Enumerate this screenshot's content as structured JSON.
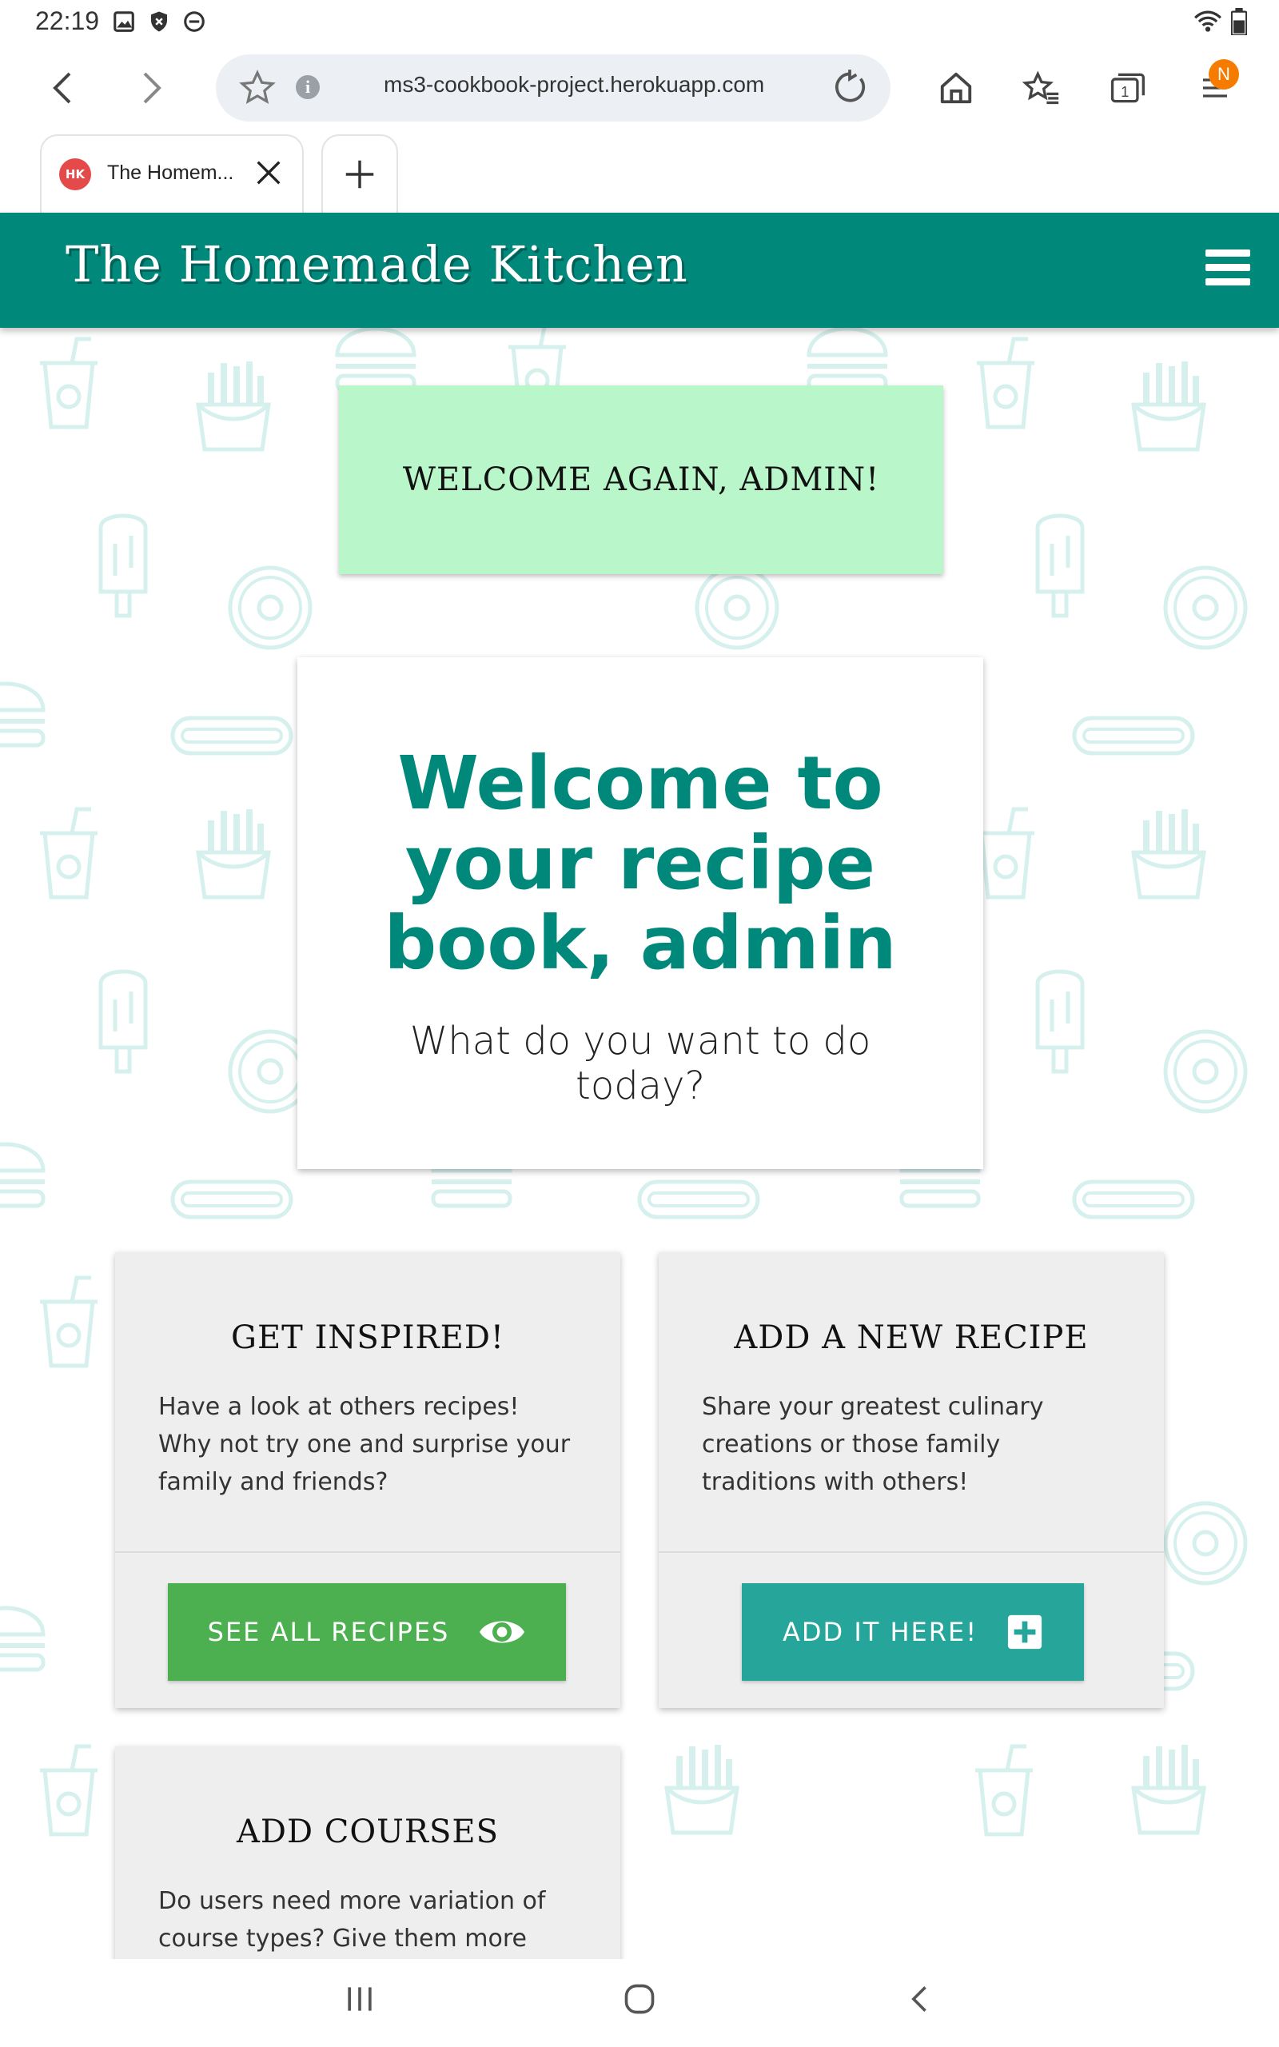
{
  "status": {
    "time": "22:19"
  },
  "browser": {
    "url": "ms3-cookbook-project.herokuapp.com",
    "tab_title": "The Homem...",
    "tab_favicon": "HK",
    "tabs_count": "1",
    "profile_badge": "N"
  },
  "site": {
    "brand": "The Homemade Kitchen"
  },
  "flash": {
    "message": "WELCOME AGAIN, ADMIN!"
  },
  "hero": {
    "title": "Welcome to your recipe book, admin",
    "subtitle": "What do you want to do today?"
  },
  "cards": [
    {
      "title": "GET INSPIRED!",
      "text": "Have a look at others recipes! Why not try one and surprise your family and friends?",
      "button": "SEE ALL RECIPES",
      "button_icon": "eye-icon"
    },
    {
      "title": "ADD A NEW RECIPE",
      "text": "Share your greatest culinary creations or those family traditions with others!",
      "button": "ADD IT HERE!",
      "button_icon": "plus-box-icon"
    },
    {
      "title": "ADD COURSES",
      "text": "Do users need more variation of course types? Give them more"
    }
  ],
  "colors": {
    "brand_teal": "#00897b",
    "flash_green": "#b9f6ca",
    "button_green": "#4caf50",
    "button_teal": "#26a69a",
    "pattern": "#d6f0ee"
  }
}
